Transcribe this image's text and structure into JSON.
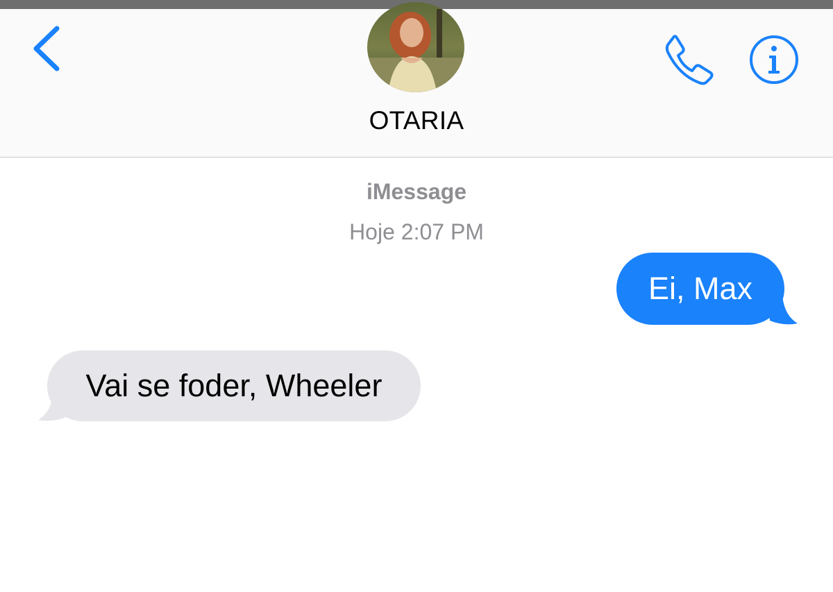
{
  "header": {
    "contact_name": "OTARIA",
    "back_icon": "chevron-left-icon",
    "call_icon": "phone-icon",
    "info_icon": "info-icon"
  },
  "conversation": {
    "service_label": "iMessage",
    "timestamp": "Hoje 2:07 PM",
    "messages": [
      {
        "direction": "outgoing",
        "text": "Ei, Max"
      },
      {
        "direction": "incoming",
        "text": "Vai se foder, Wheeler"
      }
    ]
  },
  "colors": {
    "accent": "#1a82fb",
    "incoming_bubble": "#e5e5ea",
    "meta_text": "#8e8e93"
  }
}
